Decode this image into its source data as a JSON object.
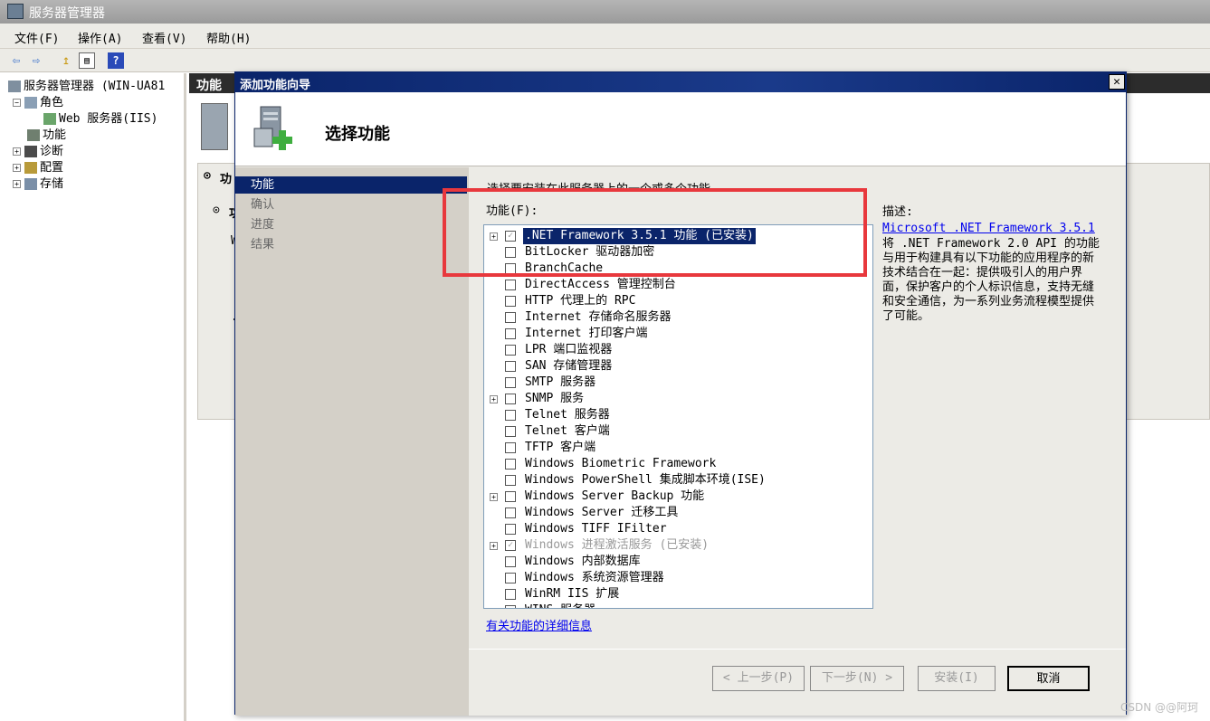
{
  "window": {
    "title": "服务器管理器"
  },
  "menu": [
    "文件(F)",
    "操作(A)",
    "查看(V)",
    "帮助(H)"
  ],
  "tree": [
    {
      "label": "服务器管理器 (WIN-UA81",
      "icon": "server-icon"
    },
    {
      "label": "角色",
      "icon": "roles-icon",
      "expander": "⊟"
    },
    {
      "label": "Web 服务器(IIS)",
      "icon": "web-server-icon"
    },
    {
      "label": "功能",
      "icon": "features-icon"
    },
    {
      "label": "诊断",
      "icon": "diagnostics-icon",
      "expander": "⊞"
    },
    {
      "label": "配置",
      "icon": "configuration-icon",
      "expander": "⊞"
    },
    {
      "label": "存储",
      "icon": "storage-icon",
      "expander": "⊞"
    }
  ],
  "right_pane": {
    "header": "功能",
    "section1": "功",
    "section2": "功",
    "row_w": "W",
    "row_dot": "."
  },
  "dialog": {
    "title": "添加功能向导",
    "close": "✕",
    "header_title": "选择功能",
    "nav": [
      "功能",
      "确认",
      "进度",
      "结果"
    ],
    "instruction": "选择要安装在此服务器上的一个或多个功能。",
    "features_label": "功能(F):",
    "features": [
      {
        "label": ".NET Framework 3.5.1 功能  (已安装)",
        "expandable": true,
        "checked": true,
        "disabled": true,
        "selected": true
      },
      {
        "label": "BitLocker 驱动器加密",
        "expandable": false,
        "checked": false
      },
      {
        "label": "BranchCache",
        "expandable": false,
        "checked": false
      },
      {
        "label": "DirectAccess 管理控制台",
        "expandable": false,
        "checked": false
      },
      {
        "label": "HTTP 代理上的 RPC",
        "expandable": false,
        "checked": false
      },
      {
        "label": "Internet 存储命名服务器",
        "expandable": false,
        "checked": false
      },
      {
        "label": "Internet 打印客户端",
        "expandable": false,
        "checked": false
      },
      {
        "label": "LPR 端口监视器",
        "expandable": false,
        "checked": false
      },
      {
        "label": "SAN 存储管理器",
        "expandable": false,
        "checked": false
      },
      {
        "label": "SMTP 服务器",
        "expandable": false,
        "checked": false
      },
      {
        "label": "SNMP 服务",
        "expandable": true,
        "checked": false
      },
      {
        "label": "Telnet 服务器",
        "expandable": false,
        "checked": false
      },
      {
        "label": "Telnet 客户端",
        "expandable": false,
        "checked": false
      },
      {
        "label": "TFTP 客户端",
        "expandable": false,
        "checked": false
      },
      {
        "label": "Windows Biometric Framework",
        "expandable": false,
        "checked": false
      },
      {
        "label": "Windows PowerShell 集成脚本环境(ISE)",
        "expandable": false,
        "checked": false
      },
      {
        "label": "Windows Server Backup 功能",
        "expandable": true,
        "checked": false
      },
      {
        "label": "Windows Server 迁移工具",
        "expandable": false,
        "checked": false
      },
      {
        "label": "Windows TIFF IFilter",
        "expandable": false,
        "checked": false
      },
      {
        "label": "Windows 进程激活服务  (已安装)",
        "expandable": true,
        "checked": true,
        "disabled": true
      },
      {
        "label": "Windows 内部数据库",
        "expandable": false,
        "checked": false
      },
      {
        "label": "Windows 系统资源管理器",
        "expandable": false,
        "checked": false
      },
      {
        "label": "WinRM IIS 扩展",
        "expandable": false,
        "checked": false
      },
      {
        "label": "WINS 服务器",
        "expandable": false,
        "checked": false
      }
    ],
    "more_info_link": "有关功能的详细信息",
    "description_label": "描述:",
    "description_link": "Microsoft .NET Framework 3.5.1",
    "description_text": "将 .NET Framework 2.0 API 的功能与用于构建具有以下功能的应用程序的新技术结合在一起：提供吸引人的用户界面，保护客户的个人标识信息，支持无缝和安全通信，为一系列业务流程模型提供了可能。",
    "buttons": {
      "prev": "< 上一步(P)",
      "next": "下一步(N) >",
      "install": "安装(I)",
      "cancel": "取消"
    }
  },
  "watermark": "CSDN @@阿珂",
  "colors": {
    "dialog_title": "#0a246a",
    "highlight_box": "#e8383d",
    "selection": "#0a246a"
  }
}
